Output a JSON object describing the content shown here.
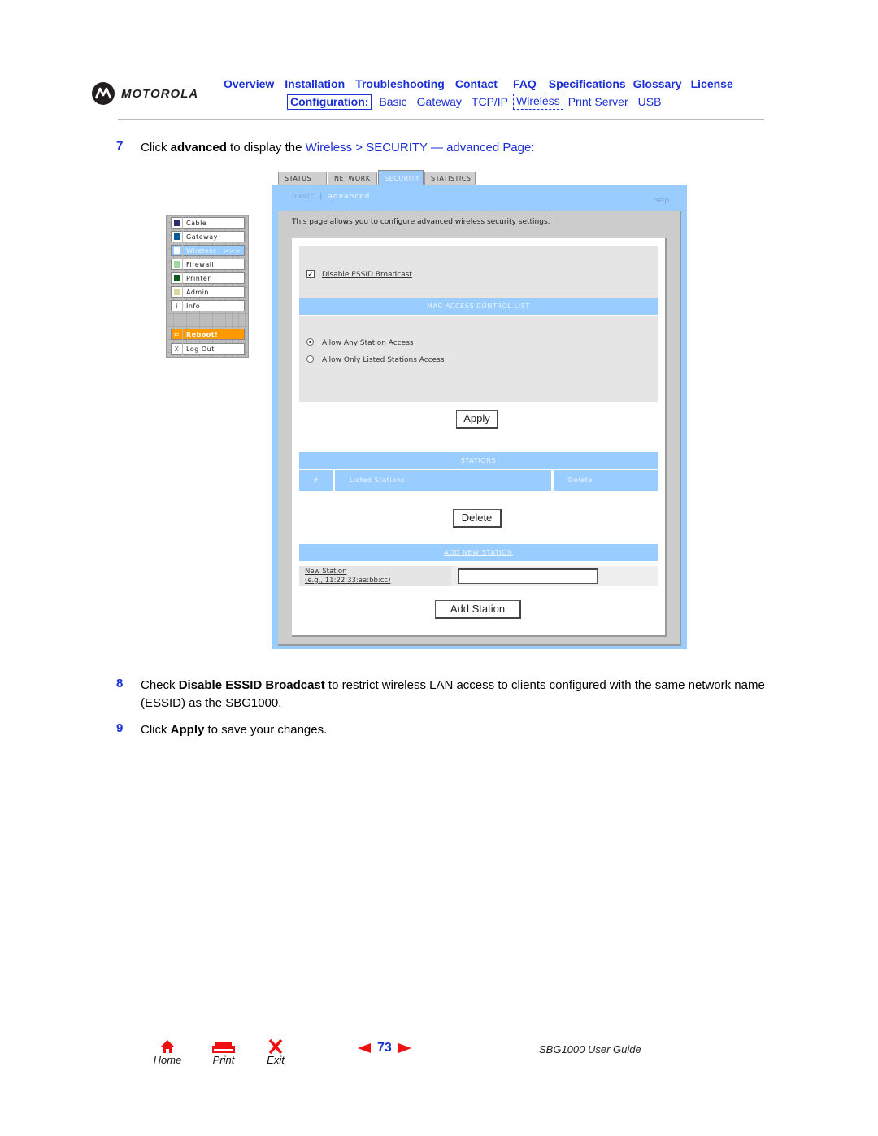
{
  "header": {
    "brand": "MOTOROLA",
    "nav_top": [
      "Overview",
      "Installation",
      "Troubleshooting",
      "Contact",
      "FAQ",
      "Specifications",
      "Glossary",
      "License"
    ],
    "config_label": "Configuration:",
    "nav_bottom": [
      "Basic",
      "Gateway",
      "TCP/IP",
      "Wireless",
      "Print Server",
      "USB"
    ],
    "current": "Wireless"
  },
  "steps": [
    {
      "num": "7",
      "pre": "Click ",
      "bold": "advanced",
      "mid": " to display the ",
      "link": "Wireless > SECURITY — advanced Page",
      "post": ":"
    },
    {
      "num": "8",
      "pre": "Check ",
      "bold": "Disable ESSID Broadcast",
      "post": " to restrict wireless LAN access to clients configured with the same network name (ESSID) as the SBG1000."
    },
    {
      "num": "9",
      "pre": "Click ",
      "bold": "Apply",
      "post": " to save your changes."
    }
  ],
  "screenshot": {
    "tabs": [
      "STATUS",
      "NETWORK",
      "SECURITY",
      "STATISTICS"
    ],
    "active_tab": "SECURITY",
    "subnav": {
      "basic": "basic",
      "advanced": "advanced",
      "help": "help"
    },
    "intro": "This page allows you to configure advanced wireless security settings.",
    "disable_essid": {
      "label": "Disable ESSID Broadcast",
      "checked": true
    },
    "mac_acl_title": "MAC ACCESS CONTROL LIST",
    "radios": [
      {
        "label": "Allow Any Station Access",
        "selected": true
      },
      {
        "label": "Allow Only Listed Stations Access",
        "selected": false
      }
    ],
    "apply_button": "Apply",
    "stations_title": "STATIONS",
    "stations_columns": [
      "#",
      "Listed Stations",
      "Delete"
    ],
    "delete_button": "Delete",
    "add_station_title": "ADD NEW STATION",
    "new_station_label": "New Station",
    "new_station_hint": "(e.g., 11:22:33:aa:bb:cc)",
    "new_station_value": "",
    "add_station_button": "Add Station",
    "side_menu": [
      {
        "label": "Cable",
        "color": "#2b2b6b"
      },
      {
        "label": "Gateway",
        "color": "#0a5a9a"
      },
      {
        "label": "Wireless",
        "color": "#ffffff",
        "suffix": ">>>"
      },
      {
        "label": "Firewall",
        "color": "#a0d8a0"
      },
      {
        "label": "Printer",
        "color": "#0a5a1a"
      },
      {
        "label": "Admin",
        "color": "#d8d8a0"
      },
      {
        "label": "Info",
        "glyph": "i"
      },
      {
        "label": "Reboot!",
        "glyph": "⇦"
      },
      {
        "label": "Log Out",
        "glyph": "X"
      }
    ]
  },
  "footer": {
    "home": "Home",
    "print": "Print",
    "exit": "Exit",
    "page_number": "73",
    "guide_title": "SBG1000 User Guide"
  }
}
